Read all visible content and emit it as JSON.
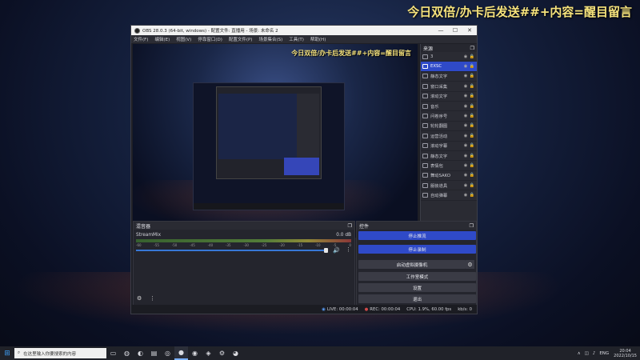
{
  "desktop": {
    "overlay_text": "今日双倍/办卡后发送##+内容=醒目留言"
  },
  "obs": {
    "title": "OBS 28.0.3 (64-bit, windows) - 配置文件: 直播用 - 场景: 未命名 2",
    "window_buttons": [
      "—",
      "☐",
      "✕"
    ],
    "menu": [
      "文件(F)",
      "编辑(E)",
      "视图(V)",
      "停靠窗口(D)",
      "配置文件(P)",
      "场景集合(S)",
      "工具(T)",
      "帮助(H)"
    ],
    "preview_overlay": "今日双倍/办卡后发送##+内容=醒目留言",
    "sources": {
      "title": "来源",
      "items": [
        {
          "name": "3",
          "selected": false
        },
        {
          "name": "EXSC",
          "selected": true
        },
        {
          "name": "静态文字",
          "selected": false
        },
        {
          "name": "窗口采集",
          "selected": false
        },
        {
          "name": "滚动文字",
          "selected": false
        },
        {
          "name": "音乐",
          "selected": false
        },
        {
          "name": "问卷序号",
          "selected": false
        },
        {
          "name": "轮轮翻图",
          "selected": false
        },
        {
          "name": "运营活动",
          "selected": false
        },
        {
          "name": "滚动字幕",
          "selected": false
        },
        {
          "name": "静态文字",
          "selected": false
        },
        {
          "name": "表情包",
          "selected": false
        },
        {
          "name": "舞动SAKO",
          "selected": false
        },
        {
          "name": "服装道具",
          "selected": false
        },
        {
          "name": "自动弹幕",
          "selected": false
        }
      ],
      "toolbar": [
        "+",
        "🗑",
        "⚙",
        "∧",
        "⋮"
      ]
    },
    "mixer": {
      "title": "混音器",
      "channel": "StreamMix",
      "db": "0.0 dB",
      "ticks": [
        "-60",
        "-55",
        "-50",
        "-45",
        "-40",
        "-35",
        "-30",
        "-25",
        "-20",
        "-15",
        "-10",
        "-5",
        "0"
      ],
      "volume_level": 1.0
    },
    "controls": {
      "title": "控件",
      "buttons": [
        "停止推流",
        "停止录制",
        "启动虚拟摄像机",
        "工作室模式",
        "设置",
        "退出"
      ]
    },
    "status": {
      "live": "LIVE: 00:00:04",
      "rec": "REC: 00:00:04",
      "cpu": "CPU: 1.9%, 60.00 fps",
      "kbps": "kb/s: 0"
    }
  },
  "taskbar": {
    "search_placeholder": "在这里输入你要搜索的内容",
    "tray_lang": "ENG",
    "time": "20:04",
    "date": "2022/10/15"
  }
}
